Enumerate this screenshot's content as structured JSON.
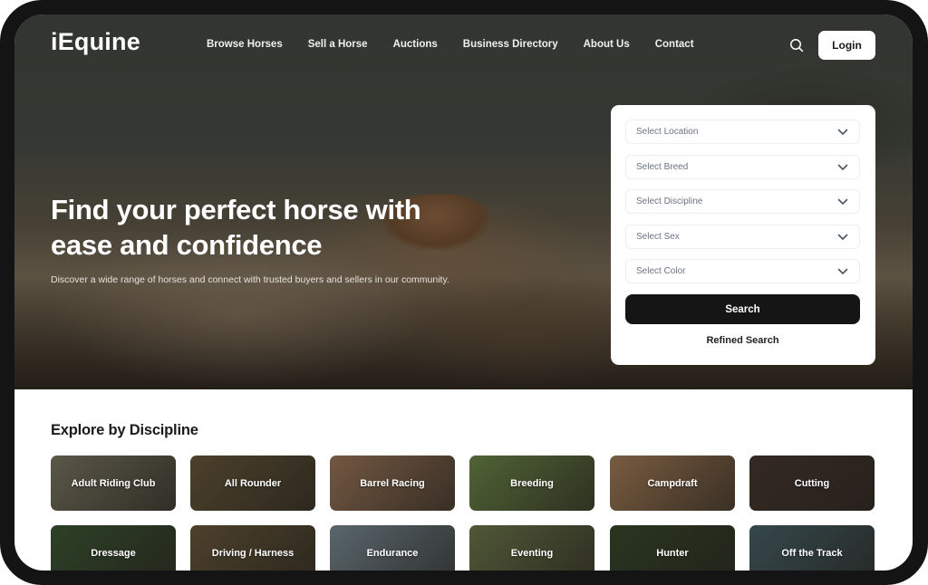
{
  "nav": {
    "logo": "iEquine",
    "links": [
      "Browse Horses",
      "Sell a Horse",
      "Auctions",
      "Business Directory",
      "About Us",
      "Contact"
    ],
    "search_icon": "search-icon",
    "login_label": "Login"
  },
  "hero": {
    "title": "Find your perfect horse with ease and confidence",
    "subtitle": "Discover a wide range of horses and connect with trusted buyers and sellers in our community."
  },
  "search_card": {
    "selects": [
      {
        "placeholder": "Select Location"
      },
      {
        "placeholder": "Select Breed"
      },
      {
        "placeholder": "Select Discipline"
      },
      {
        "placeholder": "Select Sex"
      },
      {
        "placeholder": "Select Color"
      }
    ],
    "search_label": "Search",
    "refined_label": "Refined Search"
  },
  "disciplines": {
    "title": "Explore by Discipline",
    "items": [
      {
        "label": "Adult Riding Club",
        "color": "#7d7a64"
      },
      {
        "label": "All Rounder",
        "color": "#6b5a3c"
      },
      {
        "label": "Barrel Racing",
        "color": "#a07a5c"
      },
      {
        "label": "Breeding",
        "color": "#6f8a4a"
      },
      {
        "label": "Campdraft",
        "color": "#a8805a"
      },
      {
        "label": "Cutting",
        "color": "#4a3a32"
      },
      {
        "label": "Dressage",
        "color": "#3f5a36"
      },
      {
        "label": "Driving / Harness",
        "color": "#6b5a3c"
      },
      {
        "label": "Endurance",
        "color": "#7c8e96"
      },
      {
        "label": "Eventing",
        "color": "#6f7a4c"
      },
      {
        "label": "Hunter",
        "color": "#3a4a2c"
      },
      {
        "label": "Off the Track",
        "color": "#4a6468"
      }
    ]
  }
}
